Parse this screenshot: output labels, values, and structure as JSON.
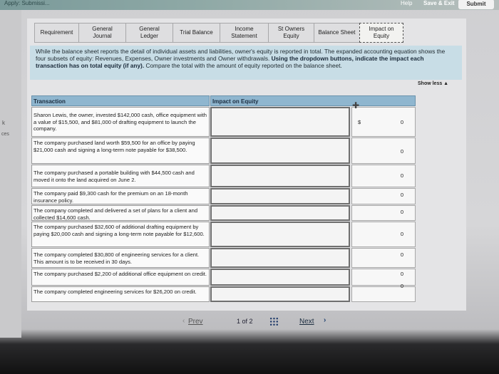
{
  "topbar": {
    "crumb": "Apply: Submissi...",
    "help": "Help",
    "save_exit": "Save & Exit",
    "submit": "Submit"
  },
  "left": {
    "arrow": "k",
    "side_text": "ces"
  },
  "tabs": [
    {
      "label": "Requirement",
      "active": false
    },
    {
      "label": "General Journal",
      "active": false
    },
    {
      "label": "General Ledger",
      "active": false
    },
    {
      "label": "Trial Balance",
      "active": false
    },
    {
      "label": "Income Statement",
      "active": false
    },
    {
      "label": "St Owners Equity",
      "active": false
    },
    {
      "label": "Balance Sheet",
      "active": false
    },
    {
      "label": "Impact on Equity",
      "active": true
    }
  ],
  "info": {
    "text_plain": "While the balance sheet reports the detail of individual assets and liabilities, owner's equity is reported in total. The expanded accounting equation shows the four subsets of equity: Revenues, Expenses, Owner investments and Owner withdrawals.",
    "text_bold": "Using the dropdown buttons, indicate the impact each transaction has on total equity (if any).",
    "text_tail": "Compare the total with the amount of equity reported on the balance sheet."
  },
  "show_less": "Show less ▲",
  "table": {
    "col_transaction": "Transaction",
    "col_impact": "Impact on Equity",
    "dollar_sign": "$",
    "rows": [
      {
        "text": "Sharon Lewis, the owner, invested $142,000 cash, office equipment with a value of $15,500, and $81,000 of drafting equipment to launch the company.",
        "value": "0"
      },
      {
        "text": "The company purchased land worth $59,500 for an office by paying $21,000 cash and signing a long-term note payable for $38,500.",
        "value": "0"
      },
      {
        "text": "The company purchased a portable building with $44,500 cash and moved it onto the land acquired on June 2.",
        "value": "0"
      },
      {
        "text": "The company paid $9,300 cash for the premium on an 18-month insurance policy.",
        "value": "0"
      },
      {
        "text": "The company completed and delivered a set of plans for a client and collected $14,600 cash.",
        "value": "0"
      },
      {
        "text": "The company purchased $32,600 of additional drafting equipment by paying $20,000 cash and signing a long-term note payable for $12,600.",
        "value": "0"
      },
      {
        "text": "The company completed $30,800 of engineering services for a client. This amount is to be received in 30 days.",
        "value": "0"
      },
      {
        "text": "The company purchased $2,200 of additional office equipment on credit.",
        "value": "0"
      },
      {
        "text": "The company completed engineering services for $26,200 on credit.",
        "value": "0"
      }
    ]
  },
  "pager": {
    "prev": "Prev",
    "count": "1 of 2",
    "next": "Next"
  }
}
